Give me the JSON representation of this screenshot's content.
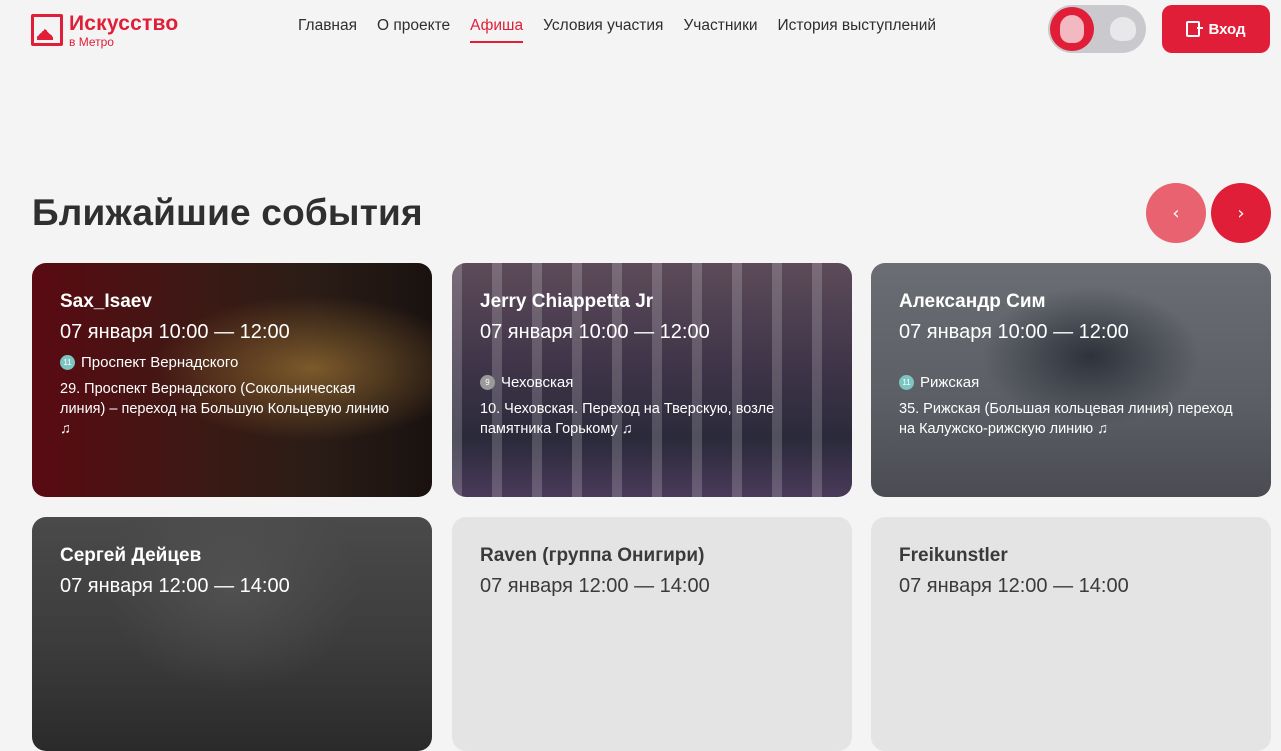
{
  "header": {
    "logo_title": "Искусство",
    "logo_sub": "в Метро",
    "nav": [
      {
        "label": "Главная"
      },
      {
        "label": "О проекте"
      },
      {
        "label": "Афиша"
      },
      {
        "label": "Условия участия"
      },
      {
        "label": "Участники"
      },
      {
        "label": "История выступлений"
      }
    ],
    "login_label": "Вход"
  },
  "section": {
    "title": "Ближайшие события",
    "prev_arrow": "‹",
    "next_arrow": "›"
  },
  "events": [
    {
      "name": "Sax_Isaev",
      "time": "07 января 10:00 — 12:00",
      "line": "11",
      "line_color": "#7bc5c2",
      "station": "Проспект Вернадского",
      "place": "29. Проспект Вернадского (Сокольническая линия) – переход на Большую Кольцевую линию ♫"
    },
    {
      "name": "Jerry Chiappetta Jr",
      "time": "07 января 10:00 — 12:00",
      "line": "9",
      "line_color": "#9a9a9a",
      "station": "Чеховская",
      "place": "10. Чеховская. Переход на Тверскую, возле памятника Горькому ♫"
    },
    {
      "name": "Александр Сим",
      "time": "07 января 10:00 — 12:00",
      "line": "11",
      "line_color": "#7bc5c2",
      "station": "Рижская",
      "place": "35. Рижская (Большая кольцевая линия) переход на Калужско-рижскую линию ♫"
    },
    {
      "name": "Сергей Дейцев",
      "time": "07 января 12:00 — 14:00"
    },
    {
      "name": "Raven (группа Онигири)",
      "time": "07 января 12:00 — 14:00"
    },
    {
      "name": "Freikunstler",
      "time": "07 января 12:00 — 14:00"
    }
  ],
  "colors": {
    "accent": "#e01e37",
    "accent_light": "#e8626f"
  }
}
